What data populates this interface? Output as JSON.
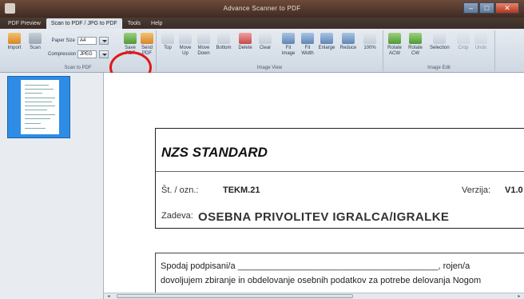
{
  "window": {
    "title": "Advance Scanner to PDF"
  },
  "tabs": [
    {
      "label": "PDF Preview"
    },
    {
      "label": "Scan to PDF / JPG to PDF"
    },
    {
      "label": "Tools"
    },
    {
      "label": "Help"
    }
  ],
  "ribbon": {
    "scan_group": {
      "caption": "Scan to PDF",
      "import_label": "Import",
      "scan_label": "Scan",
      "paper_size_label": "Paper Size",
      "paper_size_value": "A4",
      "compression_label": "Compression",
      "compression_value": "JPEG",
      "save_label": "Save\nPDF",
      "send_label": "Send\nPDF"
    },
    "image_view_group": {
      "caption": "Image View",
      "top": "Top",
      "move_up": "Move\nUp",
      "move_down": "Move\nDown",
      "bottom": "Bottom",
      "delete": "Delete",
      "clear": "Clear",
      "fit_image": "Fit\nImage",
      "fit_width": "Fit\nWidth",
      "enlarge": "Enlarge",
      "reduce": "Reduce",
      "zoom": "100%"
    },
    "image_edit_group": {
      "caption": "Image Edit",
      "rotate_acw": "Rotate\nACW",
      "rotate_cw": "Rotate\nCW",
      "selection": "Selection",
      "crop": "Crop",
      "undo": "Undo"
    }
  },
  "document": {
    "standard_title": "NZS STANDARD",
    "ref_label": "Št. / ozn.:",
    "ref_value": "TEKM.21",
    "version_label": "Verzija:",
    "version_value": "V1.0",
    "subject_label": "Zadeva:",
    "subject_value": "OSEBNA PRIVOLITEV IGRALCA/IGRALKE",
    "body_line_1": "Spodaj podpisani/a _________________________________________, rojen/a",
    "body_line_2": "dovoljujem zbiranje in obdelovanje osebnih podatkov za potrebe delovanja Nogom"
  }
}
